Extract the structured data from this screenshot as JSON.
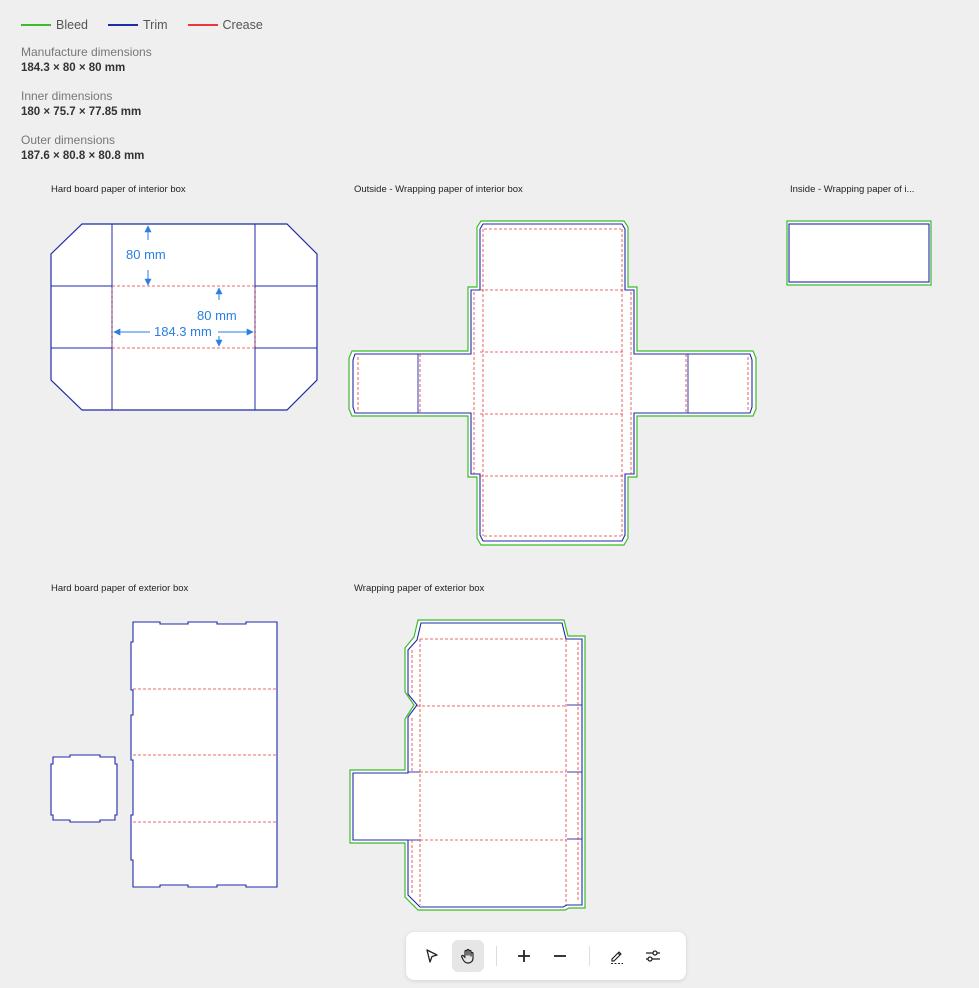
{
  "legend": [
    {
      "label": "Bleed",
      "color": "#3dbb2b"
    },
    {
      "label": "Trim",
      "color": "#1e2aa8"
    },
    {
      "label": "Crease",
      "color": "#e8383d"
    }
  ],
  "dimensions": {
    "manufacture": {
      "label": "Manufacture dimensions",
      "value": "184.3 × 80 × 80 mm"
    },
    "inner": {
      "label": "Inner dimensions",
      "value": "180 × 75.7 × 77.85 mm"
    },
    "outer": {
      "label": "Outer dimensions",
      "value": "187.6 × 80.8 × 80.8 mm"
    }
  },
  "panels": {
    "hard_interior": "Hard board paper of interior box",
    "outside_wrap_interior": "Outside - Wrapping paper of interior box",
    "inside_wrap_interior": "Inside - Wrapping paper of i...",
    "hard_exterior": "Hard board paper of exterior box",
    "wrap_exterior": "Wrapping paper of exterior box"
  },
  "measurements": {
    "height_a": "80 mm",
    "height_b": "80 mm",
    "width": "184.3 mm"
  },
  "colors": {
    "bleed": "#3dbb2b",
    "trim": "#1e2aa8",
    "crease": "#e8383d",
    "measure": "#2a7fe0"
  },
  "toolbar": {
    "tools": [
      "pointer-icon",
      "hand-icon",
      "zoom-in-icon",
      "zoom-out-icon",
      "annotate-icon",
      "settings-sliders-icon"
    ],
    "active": "hand-icon"
  }
}
